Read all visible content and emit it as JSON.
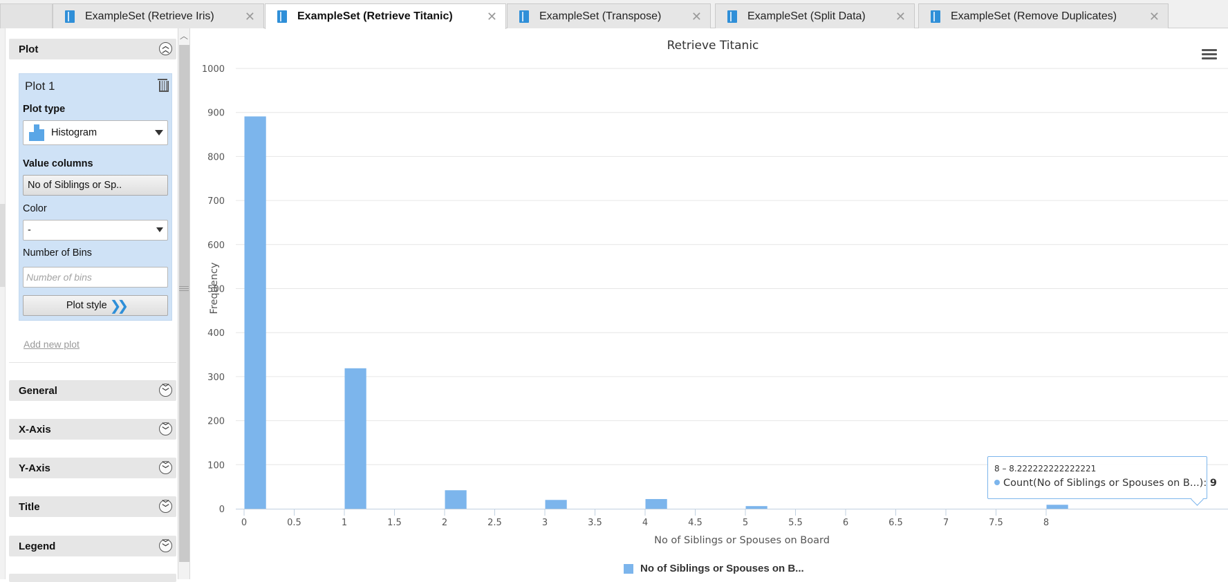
{
  "tabs": [
    {
      "label": "ExampleSet (Retrieve Iris)",
      "active": false
    },
    {
      "label": "ExampleSet (Retrieve Titanic)",
      "active": true
    },
    {
      "label": "ExampleSet (Transpose)",
      "active": false
    },
    {
      "label": "ExampleSet (Split Data)",
      "active": false
    },
    {
      "label": "ExampleSet (Remove Duplicates)",
      "active": false
    }
  ],
  "icons": {
    "tab": "exampleset-icon",
    "close": "close-icon",
    "collapse": "chevron-up-circle-icon",
    "expand": "chevron-down-circle-icon",
    "trash": "trash-icon",
    "histogram": "histogram-icon",
    "plot_style": "double-chevron-right-icon",
    "menu": "hamburger-menu-icon"
  },
  "panel": {
    "plot_section": "Plot",
    "plot_card": {
      "title": "Plot 1",
      "plot_type_label": "Plot type",
      "plot_type_value": "Histogram",
      "value_columns_label": "Value columns",
      "value_columns_button": "No of Siblings or Sp..",
      "color_label": "Color",
      "color_value": "-",
      "bins_label": "Number of Bins",
      "bins_placeholder": "Number of bins",
      "bins_value": "",
      "plot_style_button": "Plot style"
    },
    "add_new_plot": "Add new plot",
    "sections": [
      "General",
      "X-Axis",
      "Y-Axis",
      "Title",
      "Legend"
    ]
  },
  "colors": {
    "bar": "#7cb5ec",
    "card": "#cfe2f6",
    "accent": "#2f8fd8"
  },
  "tooltip": {
    "range": "8 – 8.222222222222221",
    "series": "Count(No of Siblings or Spouses on B...):",
    "value": "9"
  },
  "legend": {
    "label": "No of Siblings or Spouses on B..."
  },
  "chart_data": {
    "type": "bar",
    "title": "Retrieve Titanic",
    "xlabel": "No of Siblings or Spouses on Board",
    "ylabel": "Frequency",
    "xlim": [
      0,
      8
    ],
    "ylim": [
      0,
      1000
    ],
    "xticks": [
      "0",
      "0.5",
      "1",
      "1.5",
      "2",
      "2.5",
      "3",
      "3.5",
      "4",
      "4.5",
      "5",
      "5.5",
      "6",
      "6.5",
      "7",
      "7.5",
      "8"
    ],
    "yticks": [
      "0",
      "100",
      "200",
      "300",
      "400",
      "500",
      "600",
      "700",
      "800",
      "900",
      "1000"
    ],
    "bin_width": 0.222222222222222,
    "bins": [
      {
        "x0": 0,
        "x1": 0.2222222222,
        "value": 891
      },
      {
        "x0": 1,
        "x1": 1.2222222222,
        "value": 319
      },
      {
        "x0": 2,
        "x1": 2.2222222222,
        "value": 42
      },
      {
        "x0": 3,
        "x1": 3.2222222222,
        "value": 20
      },
      {
        "x0": 4,
        "x1": 4.2222222222,
        "value": 22
      },
      {
        "x0": 5,
        "x1": 5.2222222222,
        "value": 6
      },
      {
        "x0": 8,
        "x1": 8.2222222222,
        "value": 9
      }
    ],
    "grid": true,
    "legend_position": "bottom-center"
  }
}
